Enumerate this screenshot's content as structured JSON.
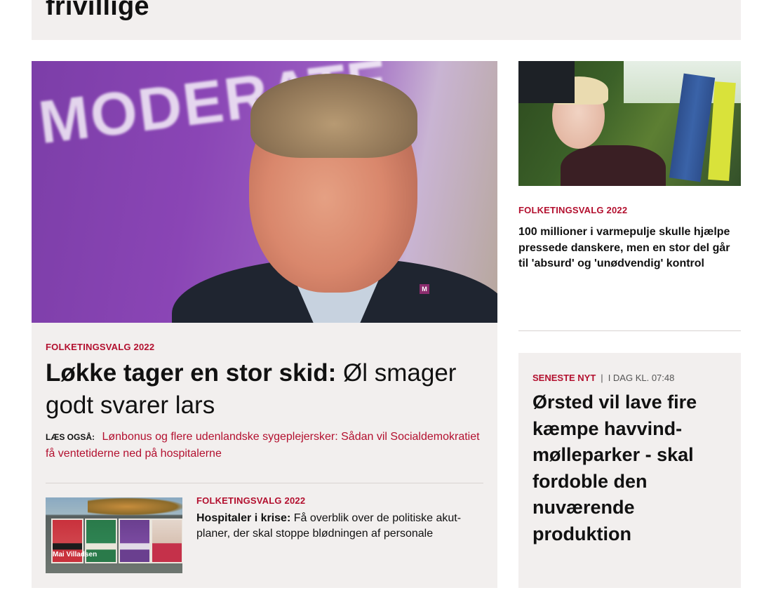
{
  "top_section": {
    "title": "frivillige"
  },
  "main_article": {
    "image_wall_text": "MODERATE",
    "image_pin_letter": "M",
    "kicker": "FOLKETINGSVALG 2022",
    "headline_strong": "Løkke tager en stor skid:",
    "headline_rest": "Øl smager godt svarer lars",
    "also_label": "LÆS OGSÅ:",
    "also_link": "Lønbonus og flere udenlandske sygeplejersker: Sådan vil Socialdemokratiet få ventetiderne ned på hospitalerne",
    "sub_article": {
      "thumb_poster_name": "Mai Villadsen",
      "kicker": "FOLKETINGSVALG 2022",
      "strong": "Hospitaler i krise:",
      "text": "Få overblik over de politiske akut-planer, der skal stoppe blødningen af personale"
    }
  },
  "side_article": {
    "kicker": "FOLKETINGSVALG 2022",
    "headline": "100 millioner i varmepulje skulle hjælpe pressede danskere, men en stor del går til 'absurd' og 'unødvendig' kontrol"
  },
  "latest_news": {
    "label": "SENESTE NYT",
    "separator": "|",
    "time": "I DAG KL. 07:48",
    "headline": "Ørsted vil lave fire kæmpe havvind-mølleparker - skal fordoble den nuværende produktion"
  },
  "colors": {
    "accent": "#b3102f",
    "card_background": "#f2efee",
    "text": "#111111"
  }
}
